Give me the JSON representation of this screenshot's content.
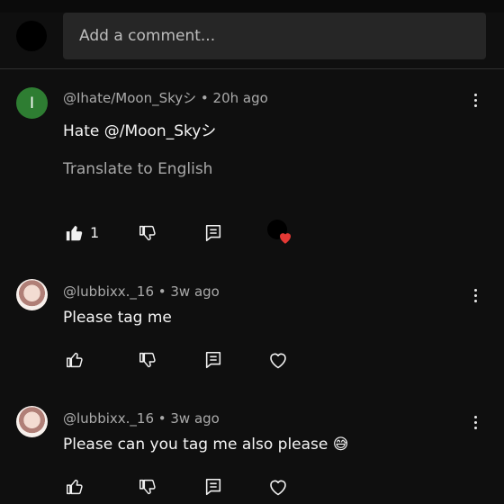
{
  "composer": {
    "placeholder": "Add a comment..."
  },
  "comments": [
    {
      "avatar_letter": "I",
      "meta": "@Ihate/Moon_Skyシ • 20h ago",
      "text": "Hate @/Moon_Skyシ",
      "translate": "Translate to English",
      "like_count": "1",
      "liked": true,
      "creator_heart": true
    },
    {
      "meta": "@lubbixx._16 • 3w ago",
      "text": "Please tag me",
      "liked": false,
      "creator_heart": false
    },
    {
      "meta": "@lubbixx._16 • 3w ago",
      "text": "Please can you tag me also please 😅",
      "liked": false,
      "creator_heart": false
    }
  ],
  "icons": {
    "like": "thumb-up-icon",
    "dislike": "thumb-down-icon",
    "reply": "reply-comment-icon",
    "heart": "heart-icon",
    "more": "more-vert-icon"
  },
  "colors": {
    "background": "#0f0f0f",
    "input": "#262626",
    "avatar_green": "#2e7d32",
    "heart_red": "#e53935"
  }
}
